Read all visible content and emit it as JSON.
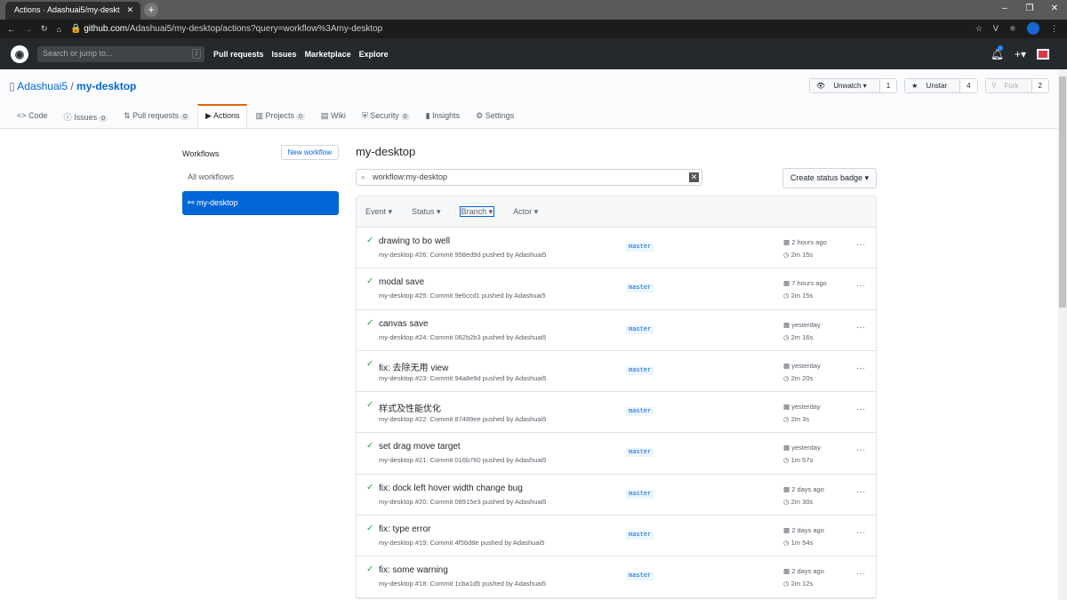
{
  "browser": {
    "tab_title": "Actions · Adashuai5/my-deskt",
    "url_host": "github.com",
    "url_path": "/Adashuai5/my-desktop/actions?query=workflow%3Amy-desktop"
  },
  "gh": {
    "search_placeholder": "Search or jump to...",
    "slash": "/",
    "nav": [
      "Pull requests",
      "Issues",
      "Marketplace",
      "Explore"
    ]
  },
  "repo": {
    "owner": "Adashuai5",
    "sep": "/",
    "name": "my-desktop",
    "unwatch": "Unwatch ▾",
    "watch_count": "1",
    "unstar": "Unstar",
    "star_count": "4",
    "fork": "Fork",
    "fork_count": "2",
    "tabs": [
      {
        "label": "Code",
        "icon": "<>"
      },
      {
        "label": "Issues",
        "count": "0",
        "icon": "ⓘ"
      },
      {
        "label": "Pull requests",
        "count": "0",
        "icon": "⇅"
      },
      {
        "label": "Actions",
        "icon": "▶"
      },
      {
        "label": "Projects",
        "count": "0",
        "icon": "▥"
      },
      {
        "label": "Wiki",
        "icon": "▤"
      },
      {
        "label": "Security",
        "count": "0",
        "icon": "⛨"
      },
      {
        "label": "Insights",
        "icon": "▮"
      },
      {
        "label": "Settings",
        "icon": "⚙"
      }
    ]
  },
  "sidebar": {
    "title": "Workflows",
    "new_workflow": "New workflow",
    "items": [
      "All workflows",
      "my-desktop"
    ]
  },
  "main": {
    "title": "my-desktop",
    "filter_value": "workflow:my-desktop",
    "create_badge": "Create status badge ▾",
    "filters": [
      "Event ▾",
      "Status ▾",
      "Branch ▾",
      "Actor ▾"
    ],
    "runs": [
      {
        "title": "drawing to bo well",
        "sub": "my-desktop #26: Commit 958ed9d pushed by Adashuai5",
        "branch": "master",
        "when": "2 hours ago",
        "duration": "2m 15s"
      },
      {
        "title": "modal save",
        "sub": "my-desktop #25: Commit 9e6ccd1 pushed by Adashuai5",
        "branch": "master",
        "when": "7 hours ago",
        "duration": "2m 15s"
      },
      {
        "title": "canvas save",
        "sub": "my-desktop #24: Commit 062b2b3 pushed by Adashuai5",
        "branch": "master",
        "when": "yesterday",
        "duration": "2m 16s"
      },
      {
        "title": "fix: 去除无用 view",
        "sub": "my-desktop #23: Commit 94a8e9d pushed by Adashuai5",
        "branch": "master",
        "when": "yesterday",
        "duration": "2m 20s"
      },
      {
        "title": "样式及性能优化",
        "sub": "my-desktop #22: Commit 87489ee pushed by Adashuai5",
        "branch": "master",
        "when": "yesterday",
        "duration": "2m 3s"
      },
      {
        "title": "set drag move target",
        "sub": "my-desktop #21: Commit 016b760 pushed by Adashuai5",
        "branch": "master",
        "when": "yesterday",
        "duration": "1m 57s"
      },
      {
        "title": "fix: dock left hover width change bug",
        "sub": "my-desktop #20: Commit 08915e3 pushed by Adashuai5",
        "branch": "master",
        "when": "2 days ago",
        "duration": "2m 30s"
      },
      {
        "title": "fix: type error",
        "sub": "my-desktop #19: Commit 4f56d8e pushed by Adashuai5",
        "branch": "master",
        "when": "2 days ago",
        "duration": "1m 54s"
      },
      {
        "title": "fix: some warning",
        "sub": "my-desktop #18: Commit 1cba1d5 pushed by Adashuai5",
        "branch": "master",
        "when": "2 days ago",
        "duration": "2m 12s"
      }
    ]
  }
}
